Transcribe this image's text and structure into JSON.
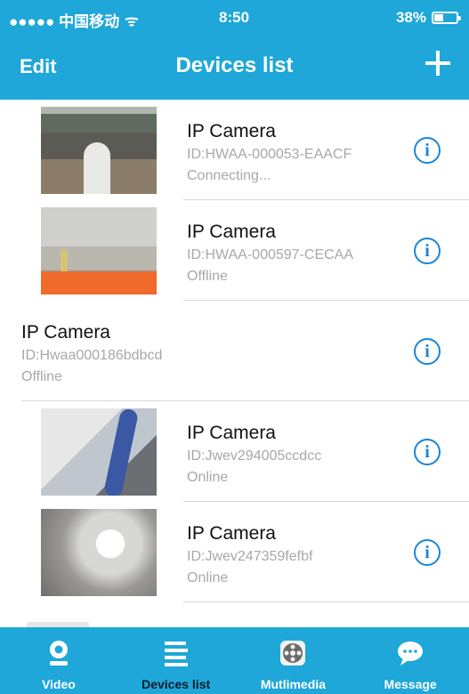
{
  "status_bar": {
    "carrier": "●●●●● 中国移动",
    "wifi": "ᯤ",
    "time": "8:50",
    "battery_percent": "38%",
    "battery_level": 0.38
  },
  "nav": {
    "edit_label": "Edit",
    "title": "Devices list",
    "add_icon": "plus-icon"
  },
  "devices": [
    {
      "name": "IP Camera",
      "id": "ID:HWAA-000053-EAACF",
      "status": "Connecting...",
      "thumbnail": "camera-thumbnail-1"
    },
    {
      "name": "IP Camera",
      "id": "ID:HWAA-000597-CECAA",
      "status": "Offline",
      "thumbnail": "camera-thumbnail-2"
    },
    {
      "name": "IP Camera",
      "id": "ID:Hwaa000186bdbcd",
      "status": "Offline",
      "thumbnail": ""
    },
    {
      "name": "IP Camera",
      "id": "ID:Jwev294005ccdcc",
      "status": "Online",
      "thumbnail": "camera-thumbnail-3"
    },
    {
      "name": "IP Camera",
      "id": "ID:Jwev247359fefbf",
      "status": "Online",
      "thumbnail": "camera-thumbnail-4"
    }
  ],
  "info_icon": "info-icon",
  "tabs": [
    {
      "label": "Video",
      "icon": "webcam-icon"
    },
    {
      "label": "Devices list",
      "icon": "list-icon",
      "active": true
    },
    {
      "label": "Mutlimedia",
      "icon": "film-reel-icon"
    },
    {
      "label": "Message",
      "icon": "chat-bubble-icon"
    }
  ],
  "colors": {
    "accent": "#1ea7d8",
    "info": "#1a85d6"
  }
}
